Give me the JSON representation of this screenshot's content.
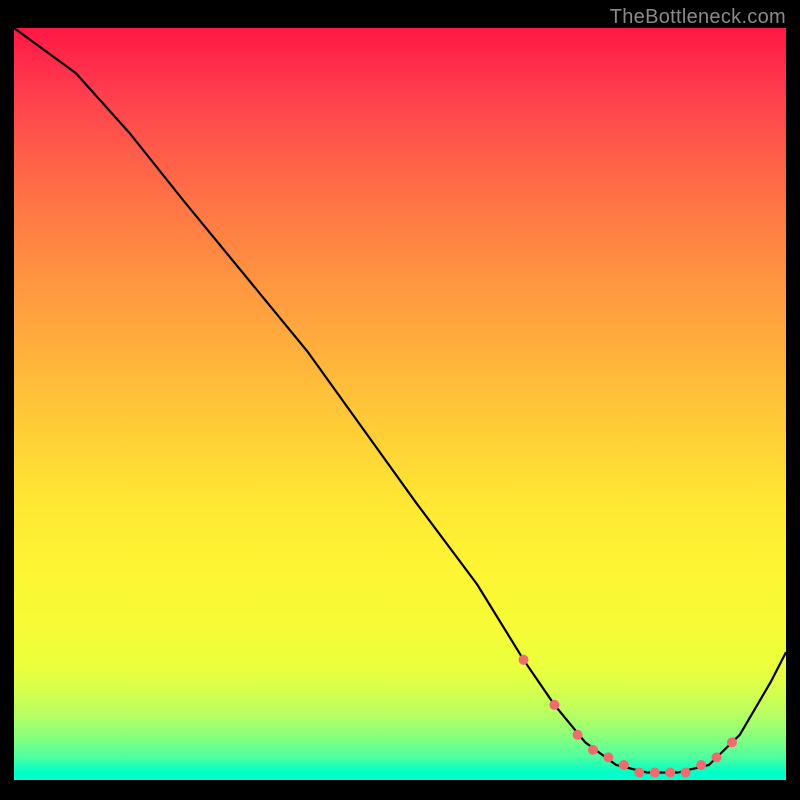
{
  "watermark": "TheBottleneck.com",
  "colors": {
    "background": "#000000",
    "curve": "#000000",
    "dot": "#ee6b6e",
    "gradient_top": "#ff1744",
    "gradient_mid": "#ffe933",
    "gradient_bottom": "#00ffd4"
  },
  "chart_data": {
    "type": "line",
    "title": "",
    "xlabel": "",
    "ylabel": "",
    "xlim": [
      0,
      100
    ],
    "ylim": [
      0,
      100
    ],
    "series": [
      {
        "name": "bottleneck-curve",
        "x": [
          0,
          8,
          15,
          22,
          30,
          38,
          45,
          52,
          60,
          66,
          70,
          74,
          78,
          82,
          86,
          90,
          94,
          98,
          100
        ],
        "values": [
          100,
          94,
          86,
          77,
          67,
          57,
          47,
          37,
          26,
          16,
          10,
          5,
          2,
          1,
          1,
          2,
          6,
          13,
          17
        ]
      }
    ],
    "highlight_points": {
      "comment": "pale-red dots along the valley of the curve",
      "x": [
        66,
        70,
        73,
        75,
        77,
        79,
        81,
        83,
        85,
        87,
        89,
        91,
        93
      ],
      "values": [
        16,
        10,
        6,
        4,
        3,
        2,
        1,
        1,
        1,
        1,
        2,
        3,
        5
      ]
    }
  }
}
